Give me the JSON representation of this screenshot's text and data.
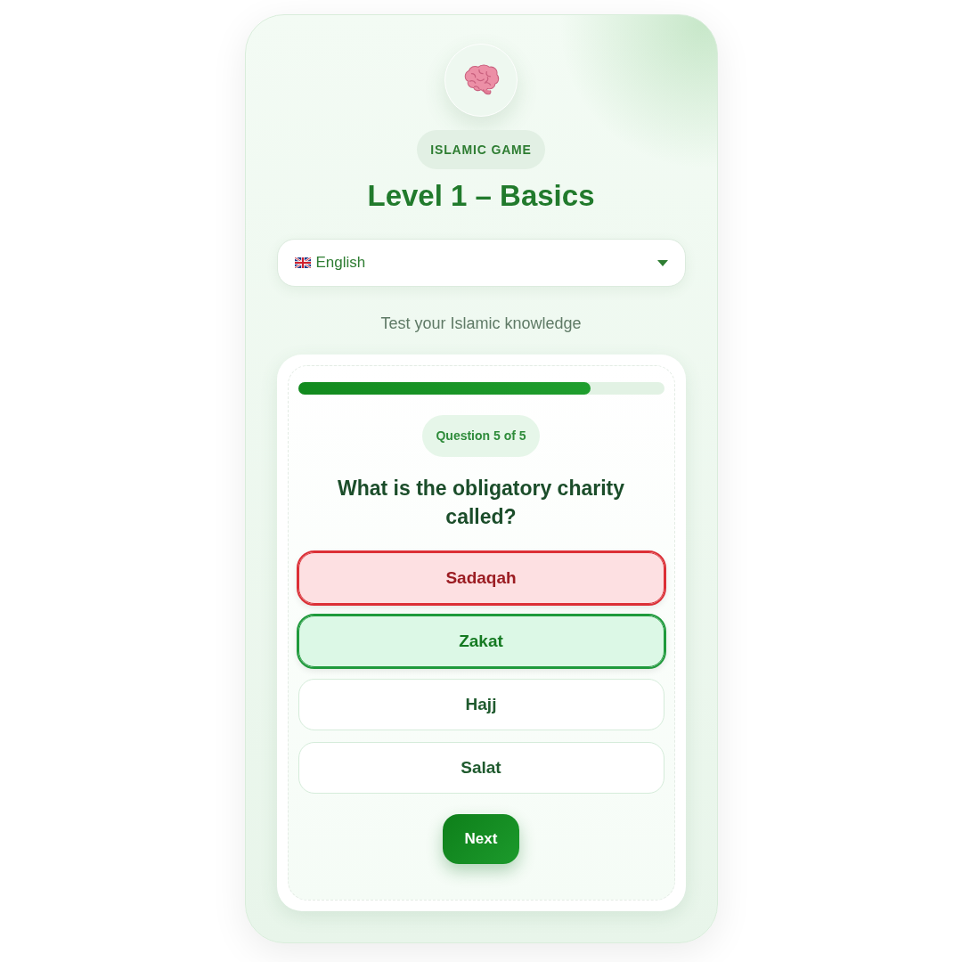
{
  "header": {
    "badge": "ISLAMIC GAME",
    "title": "Level 1 – Basics"
  },
  "language_select": {
    "value": "English"
  },
  "subtitle": "Test your Islamic knowledge",
  "quiz": {
    "progress": {
      "level": 0.8
    },
    "counter": "Question 5 of 5",
    "question": "What is the obligatory charity called?",
    "options": [
      {
        "label": "Sadaqah",
        "kind": "wrong"
      },
      {
        "label": "Zakat",
        "kind": "correct"
      },
      {
        "label": "Hajj",
        "kind": "plain"
      },
      {
        "label": "Salat",
        "kind": "plain"
      }
    ],
    "next_button": "Next"
  }
}
